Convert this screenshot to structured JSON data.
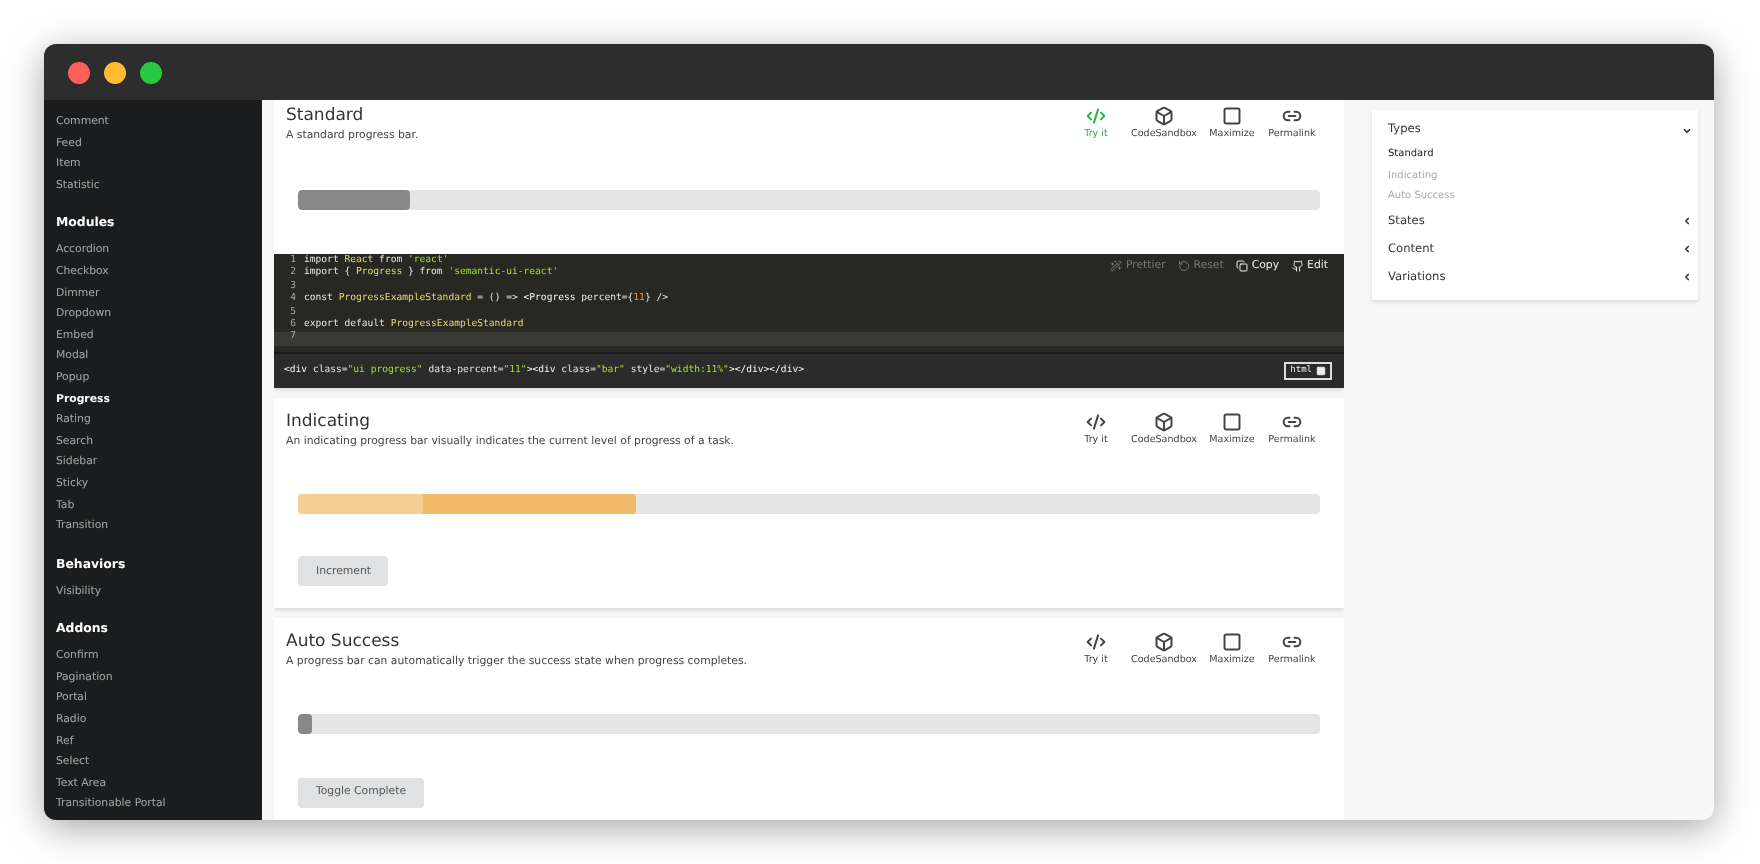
{
  "sidebar": {
    "groups": [
      {
        "items": [
          {
            "label": "Comment",
            "selected": false
          },
          {
            "label": "Feed",
            "selected": false
          },
          {
            "label": "Item",
            "selected": false
          },
          {
            "label": "Statistic",
            "selected": false
          }
        ]
      },
      {
        "title": "Modules",
        "items": [
          {
            "label": "Accordion",
            "selected": false
          },
          {
            "label": "Checkbox",
            "selected": false
          },
          {
            "label": "Dimmer",
            "selected": false
          },
          {
            "label": "Dropdown",
            "selected": false
          },
          {
            "label": "Embed",
            "selected": false
          },
          {
            "label": "Modal",
            "selected": false
          },
          {
            "label": "Popup",
            "selected": false
          },
          {
            "label": "Progress",
            "selected": true
          },
          {
            "label": "Rating",
            "selected": false
          },
          {
            "label": "Search",
            "selected": false
          },
          {
            "label": "Sidebar",
            "selected": false
          },
          {
            "label": "Sticky",
            "selected": false
          },
          {
            "label": "Tab",
            "selected": false
          },
          {
            "label": "Transition",
            "selected": false
          }
        ]
      },
      {
        "title": "Behaviors",
        "items": [
          {
            "label": "Visibility",
            "selected": false
          }
        ]
      },
      {
        "title": "Addons",
        "items": [
          {
            "label": "Confirm",
            "selected": false
          },
          {
            "label": "Pagination",
            "selected": false
          },
          {
            "label": "Portal",
            "selected": false
          },
          {
            "label": "Radio",
            "selected": false
          },
          {
            "label": "Ref",
            "selected": false
          },
          {
            "label": "Select",
            "selected": false
          },
          {
            "label": "Text Area",
            "selected": false
          },
          {
            "label": "Transitionable Portal",
            "selected": false
          }
        ]
      }
    ]
  },
  "examples": [
    {
      "title": "Standard",
      "description": "A standard progress bar.",
      "kind": "standard",
      "level": 0.11,
      "actions": [
        {
          "kind": "code",
          "label": "Try it",
          "selected": true
        },
        {
          "kind": "sandbox",
          "label": "CodeSandbox",
          "selected": false
        },
        {
          "kind": "maximize",
          "label": "Maximize",
          "selected": false
        },
        {
          "kind": "link",
          "label": "Permalink",
          "selected": false
        }
      ],
      "code": {
        "toolbar": [
          {
            "kind": "wand",
            "label": "Prettier",
            "disabled": true
          },
          {
            "kind": "reset",
            "label": "Reset",
            "disabled": true
          },
          {
            "kind": "copy",
            "label": "Copy",
            "disabled": false
          },
          {
            "kind": "github",
            "label": "Edit",
            "disabled": false
          }
        ],
        "lines": [
          {
            "number": "1",
            "active": false,
            "tokens": [
              {
                "kind": "kw",
                "text": "import "
              },
              {
                "kind": "id",
                "text": "React"
              },
              {
                "kind": "kw",
                "text": " from "
              },
              {
                "kind": "str",
                "text": "'react'"
              }
            ]
          },
          {
            "number": "2",
            "active": false,
            "tokens": [
              {
                "kind": "kw",
                "text": "import { "
              },
              {
                "kind": "id",
                "text": "Progress"
              },
              {
                "kind": "kw",
                "text": " } from "
              },
              {
                "kind": "str",
                "text": "'semantic-ui-react'"
              }
            ]
          },
          {
            "number": "3",
            "active": false
          },
          {
            "number": "4",
            "active": false,
            "tokens": [
              {
                "kind": "kw",
                "text": "const "
              },
              {
                "kind": "id",
                "text": "ProgressExampleStandard"
              },
              {
                "kind": "kw",
                "text": " = () => "
              },
              {
                "kind": "tag",
                "text": "<Progress"
              },
              {
                "kind": "kw",
                "text": " percent={"
              },
              {
                "kind": "num",
                "text": "11"
              },
              {
                "kind": "kw",
                "text": "} />"
              }
            ]
          },
          {
            "number": "5",
            "active": false
          },
          {
            "number": "6",
            "active": false,
            "tokens": [
              {
                "kind": "kw",
                "text": "export default "
              },
              {
                "kind": "id",
                "text": "ProgressExampleStandard"
              }
            ]
          },
          {
            "number": "7",
            "active": true
          }
        ],
        "html": [
          {
            "kind": "tag",
            "text": "<div "
          },
          {
            "kind": "kw",
            "text": "class="
          },
          {
            "kind": "str",
            "text": "\"ui progress\""
          },
          {
            "kind": "kw",
            "text": " data-percent="
          },
          {
            "kind": "str",
            "text": "\"11\""
          },
          {
            "kind": "tag",
            "text": "><div "
          },
          {
            "kind": "kw",
            "text": "class="
          },
          {
            "kind": "str",
            "text": "\"bar\""
          },
          {
            "kind": "kw",
            "text": " style="
          },
          {
            "kind": "str",
            "text": "\"width:11%\""
          },
          {
            "kind": "tag",
            "text": "></div></div>"
          }
        ],
        "html_badge": "html"
      }
    },
    {
      "title": "Indicating",
      "description": "An indicating progress bar visually indicates the current level of progress of a task.",
      "kind": "indicating",
      "level": 0.33,
      "button": "Increment",
      "actions": [
        {
          "kind": "code",
          "label": "Try it",
          "selected": false
        },
        {
          "kind": "sandbox",
          "label": "CodeSandbox",
          "selected": false
        },
        {
          "kind": "maximize",
          "label": "Maximize",
          "selected": false
        },
        {
          "kind": "link",
          "label": "Permalink",
          "selected": false
        }
      ]
    },
    {
      "title": "Auto Success",
      "description": "A progress bar can automatically trigger the success state when progress completes.",
      "kind": "standard",
      "level": 0.0,
      "button": "Toggle Complete",
      "actions": [
        {
          "kind": "code",
          "label": "Try it",
          "selected": false
        },
        {
          "kind": "sandbox",
          "label": "CodeSandbox",
          "selected": false
        },
        {
          "kind": "maximize",
          "label": "Maximize",
          "selected": false
        },
        {
          "kind": "link",
          "label": "Permalink",
          "selected": false
        }
      ]
    }
  ],
  "toc": [
    {
      "label": "Types",
      "expanded": true,
      "children": [
        {
          "label": "Standard",
          "selected": true
        },
        {
          "label": "Indicating",
          "selected": false
        },
        {
          "label": "Auto Success",
          "selected": false
        }
      ]
    },
    {
      "label": "States",
      "expanded": false
    },
    {
      "label": "Content",
      "expanded": false
    },
    {
      "label": "Variations",
      "expanded": false
    }
  ]
}
